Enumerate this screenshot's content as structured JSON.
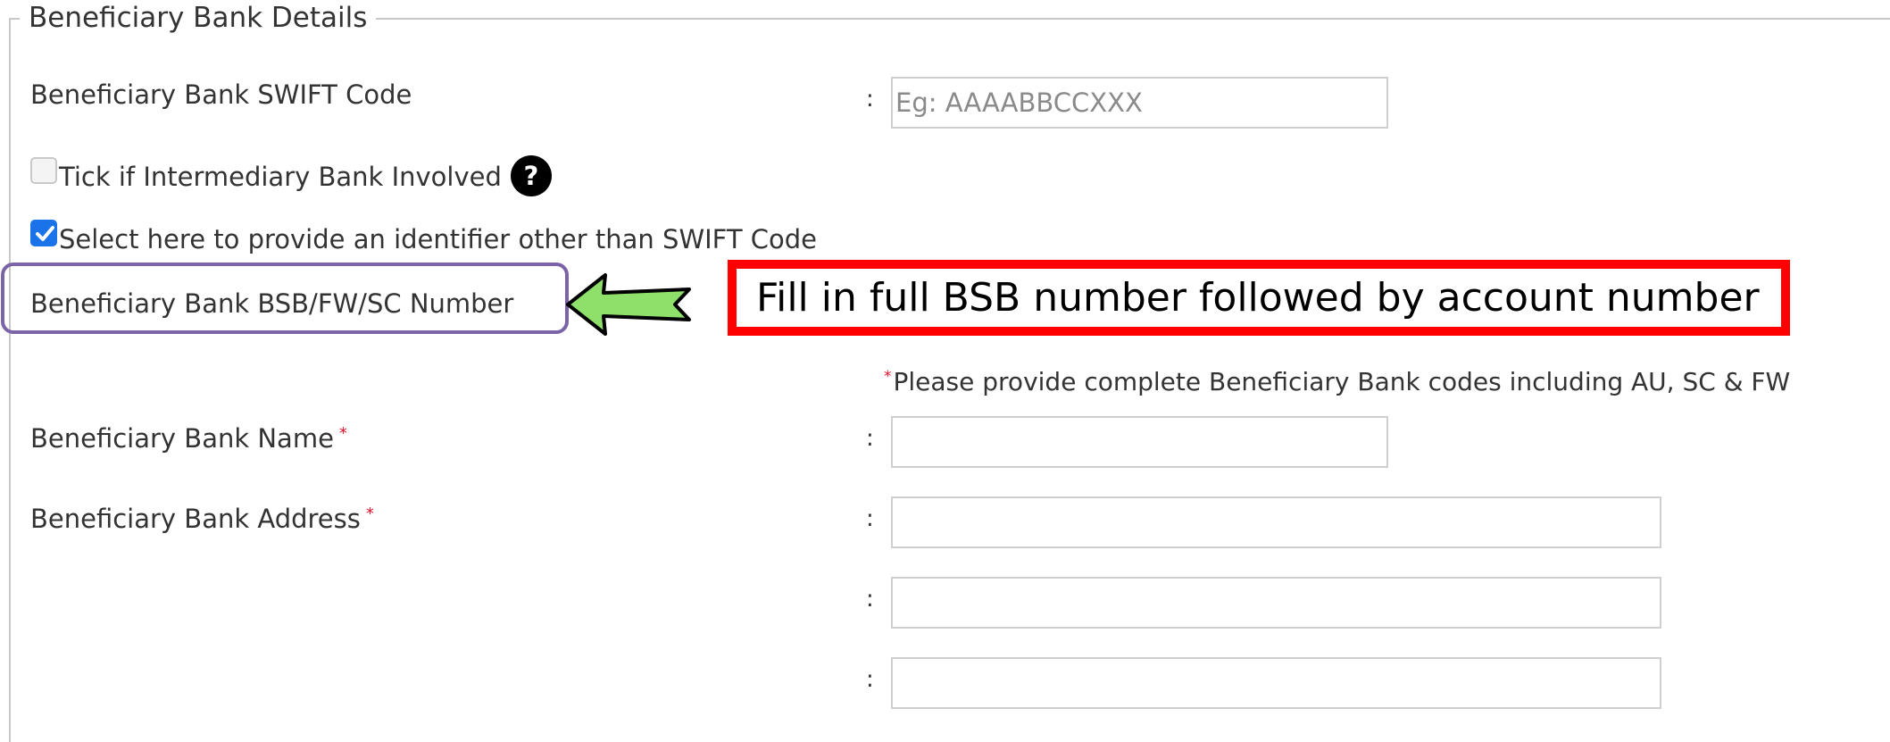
{
  "section": {
    "legend": "Beneficiary Bank Details"
  },
  "swift": {
    "label": "Beneficiary Bank SWIFT Code",
    "colon": ":",
    "placeholder": "Eg: AAAABBCCXXX",
    "value": ""
  },
  "intermediary": {
    "label": "Tick if Intermediary Bank Involved",
    "checked": false,
    "help_icon": "question-circle-icon",
    "help_text": "?"
  },
  "other_identifier": {
    "label": "Select here to provide an identifier other than SWIFT Code",
    "checked": true
  },
  "bsb": {
    "label": "Beneficiary Bank BSB/FW/SC Number",
    "hint_star": "*",
    "hint": "Please provide complete Beneficiary Bank codes including AU, SC & FW"
  },
  "bank_name": {
    "label": "Beneficiary Bank Name",
    "required": "*",
    "colon": ":",
    "value": ""
  },
  "bank_address": {
    "label": "Beneficiary Bank Address",
    "required": "*",
    "lines": [
      {
        "colon": ":",
        "value": ""
      },
      {
        "colon": ":",
        "value": ""
      },
      {
        "colon": ":",
        "value": ""
      }
    ]
  },
  "annotation": {
    "callout_text": "Fill in full BSB number followed by account number",
    "arrow_icon": "green-left-arrow-icon",
    "colors": {
      "highlight_border": "#7a63a6",
      "callout_border": "#ff0000",
      "arrow_fill": "#8ee06a"
    }
  },
  "colors": {
    "checkbox_accent": "#1a73e8",
    "required": "#e0132b"
  }
}
